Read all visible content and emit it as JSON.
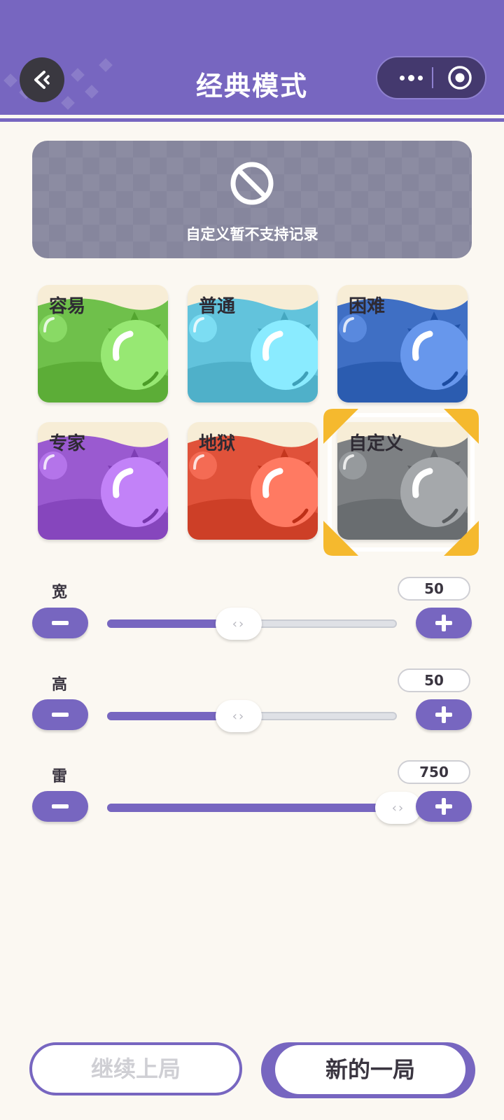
{
  "header": {
    "title": "经典模式",
    "back_icon": "back-arrow-icon",
    "more_icon": "more-dots-icon",
    "close_icon": "target-circle-icon",
    "colors": {
      "header_bg": "#7766c0",
      "capsule_bg": "#44396e"
    }
  },
  "banner": {
    "icon": "prohibited-icon",
    "text": "自定义暂不支持记录"
  },
  "modes": [
    {
      "label": "容易",
      "color": "#6fc04b",
      "selected": false
    },
    {
      "label": "普通",
      "color": "#62c3dc",
      "selected": false
    },
    {
      "label": "困难",
      "color": "#3f6fc4",
      "selected": false
    },
    {
      "label": "专家",
      "color": "#9a5ad0",
      "selected": false
    },
    {
      "label": "地狱",
      "color": "#e0523a",
      "selected": false
    },
    {
      "label": "自定义",
      "color": "#7d8083",
      "selected": true
    }
  ],
  "sliders": [
    {
      "label": "宽",
      "value": "50",
      "fraction": 0.45
    },
    {
      "label": "高",
      "value": "50",
      "fraction": 0.45
    },
    {
      "label": "雷",
      "value": "750",
      "fraction": 1.0
    }
  ],
  "buttons": {
    "continue_label": "继续上局",
    "new_label": "新的一局"
  }
}
